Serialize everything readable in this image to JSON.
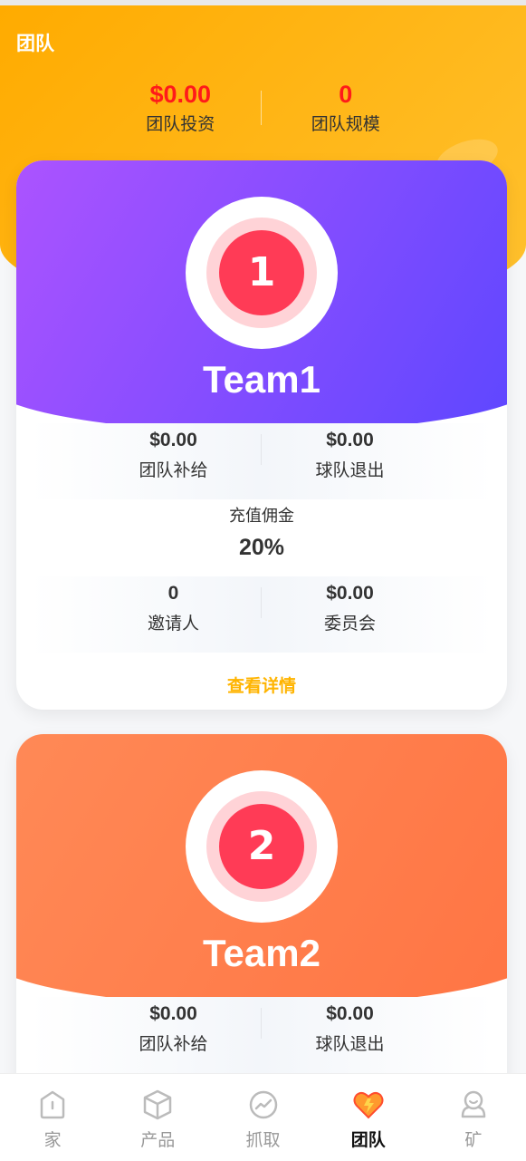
{
  "header": {
    "title": "团队",
    "stats": [
      {
        "value": "$0.00",
        "label": "团队投资"
      },
      {
        "value": "0",
        "label": "团队规模"
      }
    ]
  },
  "cards": [
    {
      "badge": "1",
      "name": "Team1",
      "row1": [
        {
          "value": "$0.00",
          "label": "团队补给"
        },
        {
          "value": "$0.00",
          "label": "球队退出"
        }
      ],
      "commission_label": "充值佣金",
      "commission_value": "20%",
      "row2": [
        {
          "value": "0",
          "label": "邀请人"
        },
        {
          "value": "$0.00",
          "label": "委员会"
        }
      ],
      "details": "查看详情",
      "accent": "#7a4cff"
    },
    {
      "badge": "2",
      "name": "Team2",
      "row1": [
        {
          "value": "$0.00",
          "label": "团队补给"
        },
        {
          "value": "$0.00",
          "label": "球队退出"
        }
      ],
      "accent": "#ff7e4a"
    }
  ],
  "tabbar": {
    "items": [
      {
        "label": "家",
        "icon": "home-icon"
      },
      {
        "label": "产品",
        "icon": "box-icon"
      },
      {
        "label": "抓取",
        "icon": "trend-icon"
      },
      {
        "label": "团队",
        "icon": "heart-icon",
        "active": true
      },
      {
        "label": "矿",
        "icon": "user-icon"
      }
    ]
  },
  "colors": {
    "header": "#ffb300",
    "price_red": "#ff1a1a",
    "link": "#ffb400"
  }
}
